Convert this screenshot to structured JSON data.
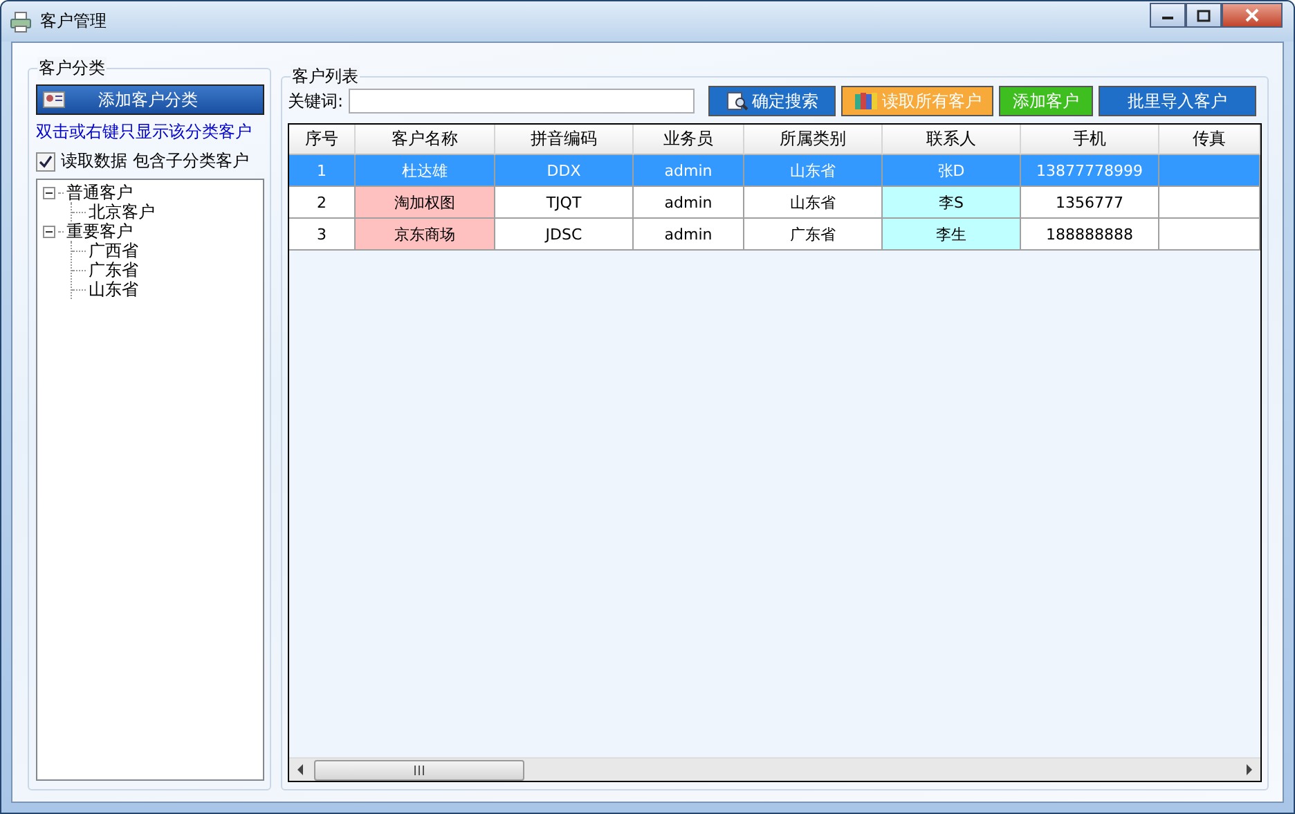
{
  "window": {
    "title": "客户管理"
  },
  "category_panel": {
    "title": "客户分类",
    "add_button": "添加客户分类",
    "hint": "双击或右键只显示该分类客户",
    "include_sub": {
      "label": "读取数据 包含子分类客户",
      "checked": true
    },
    "tree": [
      {
        "label": "普通客户",
        "expanded": true,
        "children": [
          {
            "label": "北京客户"
          }
        ]
      },
      {
        "label": "重要客户",
        "expanded": true,
        "children": [
          {
            "label": "广西省"
          },
          {
            "label": "广东省"
          },
          {
            "label": "山东省"
          }
        ]
      }
    ]
  },
  "list_panel": {
    "title": "客户列表",
    "keyword_label": "关键词:",
    "buttons": [
      {
        "label": "确定搜索",
        "color": "#1f6fc8"
      },
      {
        "label": "读取所有客户",
        "color": "#f7a93a"
      },
      {
        "label": "添加客户",
        "color": "#3fbf1f"
      },
      {
        "label": "批里导入客户",
        "color": "#1f6fc8"
      }
    ],
    "table": {
      "columns": [
        "序号",
        "客户名称",
        "拼音编码",
        "业务员",
        "所属类别",
        "联系人",
        "手机",
        "传真"
      ],
      "rows": [
        {
          "selected": true,
          "cells": [
            {
              "text": "1"
            },
            {
              "text": "杜达雄"
            },
            {
              "text": "DDX"
            },
            {
              "text": "admin"
            },
            {
              "text": "山东省"
            },
            {
              "text": "张D"
            },
            {
              "text": "13877778999"
            }
          ]
        },
        {
          "selected": false,
          "cells": [
            {
              "text": "2"
            },
            {
              "text": "淘加权图",
              "color": "#ffc0c0"
            },
            {
              "text": "TJQT"
            },
            {
              "text": "admin"
            },
            {
              "text": "山东省"
            },
            {
              "text": "李S",
              "color": "#c0ffff"
            },
            {
              "text": "1356777"
            }
          ]
        },
        {
          "selected": false,
          "cells": [
            {
              "text": "3"
            },
            {
              "text": "京东商场",
              "color": "#ffc0c0"
            },
            {
              "text": "JDSC"
            },
            {
              "text": "admin"
            },
            {
              "text": "广东省"
            },
            {
              "text": "李生",
              "color": "#c0ffff"
            },
            {
              "text": "188888888"
            }
          ]
        }
      ]
    }
  }
}
